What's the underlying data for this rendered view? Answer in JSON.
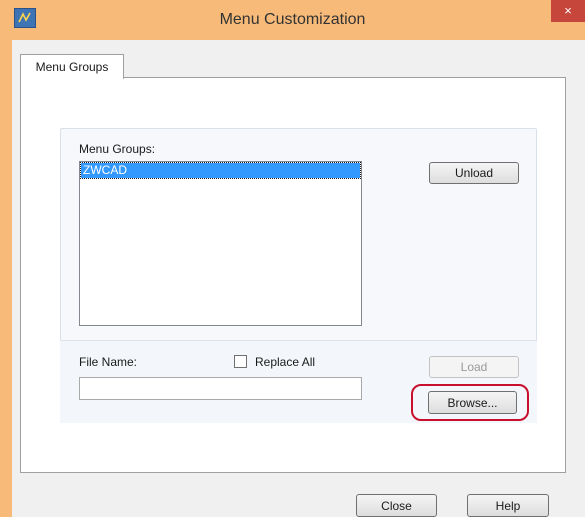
{
  "window": {
    "title": "Menu Customization",
    "close_glyph": "×",
    "icon": "app-icon"
  },
  "tabs": [
    {
      "label": "Menu Groups",
      "selected": true
    }
  ],
  "menu_groups": {
    "label": "Menu Groups:",
    "items": [
      "ZWCAD"
    ],
    "selected_index": 0
  },
  "buttons": {
    "unload": "Unload",
    "load": "Load",
    "browse": "Browse...",
    "close": "Close",
    "help": "Help"
  },
  "file": {
    "label": "File Name:",
    "value": "",
    "replace_all_label": "Replace All",
    "replace_all_checked": false
  },
  "colors": {
    "frame": "#f7ba79",
    "selection": "#3399ff",
    "highlight_ring": "#c8102e"
  }
}
